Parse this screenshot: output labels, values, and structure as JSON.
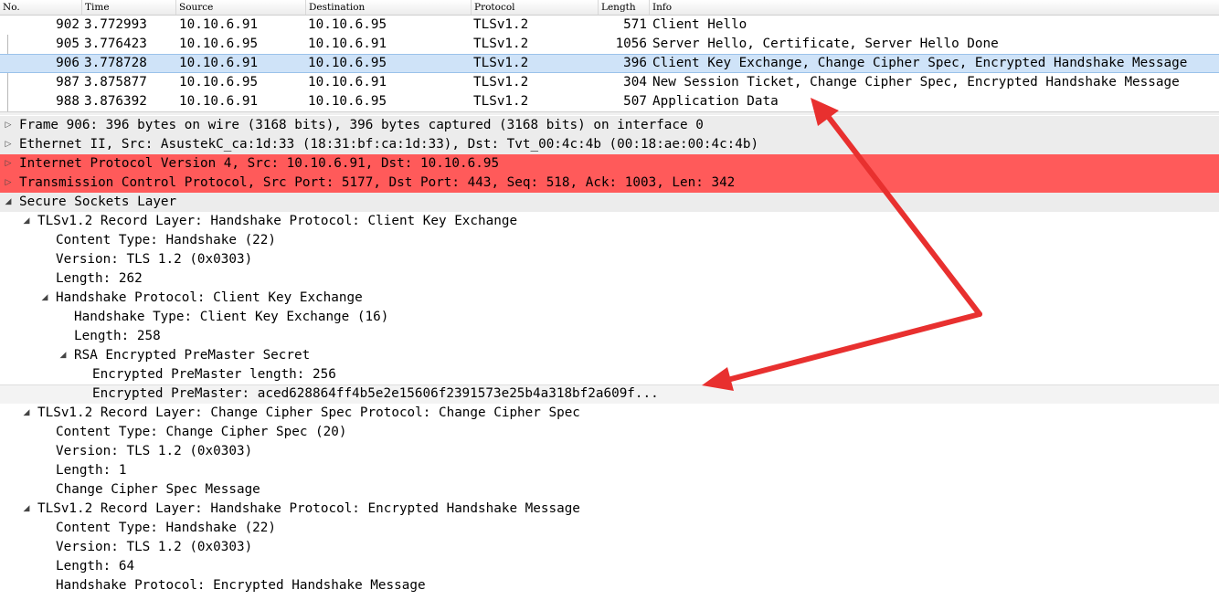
{
  "packet_list": {
    "columns": [
      "No.",
      "Time",
      "Source",
      "Destination",
      "Protocol",
      "Length",
      "Info"
    ],
    "rows": [
      {
        "no": "902",
        "time": "3.772993",
        "source": "10.10.6.91",
        "destination": "10.10.6.95",
        "protocol": "TLSv1.2",
        "length": "571",
        "info": "Client Hello"
      },
      {
        "no": "905",
        "time": "3.776423",
        "source": "10.10.6.95",
        "destination": "10.10.6.91",
        "protocol": "TLSv1.2",
        "length": "1056",
        "info": "Server Hello, Certificate, Server Hello Done"
      },
      {
        "no": "906",
        "time": "3.778728",
        "source": "10.10.6.91",
        "destination": "10.10.6.95",
        "protocol": "TLSv1.2",
        "length": "396",
        "info": "Client Key Exchange, Change Cipher Spec, Encrypted Handshake Message"
      },
      {
        "no": "987",
        "time": "3.875877",
        "source": "10.10.6.95",
        "destination": "10.10.6.91",
        "protocol": "TLSv1.2",
        "length": "304",
        "info": "New Session Ticket, Change Cipher Spec, Encrypted Handshake Message"
      },
      {
        "no": "988",
        "time": "3.876392",
        "source": "10.10.6.91",
        "destination": "10.10.6.95",
        "protocol": "TLSv1.2",
        "length": "507",
        "info": "Application Data"
      }
    ]
  },
  "details": {
    "lines": [
      {
        "text": "Frame 906: 396 bytes on wire (3168 bits), 396 bytes captured (3168 bits) on interface 0"
      },
      {
        "text": "Ethernet II, Src: AsustekC_ca:1d:33 (18:31:bf:ca:1d:33), Dst: Tvt_00:4c:4b (00:18:ae:00:4c:4b)"
      },
      {
        "text": "Internet Protocol Version 4, Src: 10.10.6.91, Dst: 10.10.6.95"
      },
      {
        "text": "Transmission Control Protocol, Src Port: 5177, Dst Port: 443, Seq: 518, Ack: 1003, Len: 342"
      },
      {
        "text": "Secure Sockets Layer"
      },
      {
        "text": "TLSv1.2 Record Layer: Handshake Protocol: Client Key Exchange"
      },
      {
        "text": "Content Type: Handshake (22)"
      },
      {
        "text": "Version: TLS 1.2 (0x0303)"
      },
      {
        "text": "Length: 262"
      },
      {
        "text": "Handshake Protocol: Client Key Exchange"
      },
      {
        "text": "Handshake Type: Client Key Exchange (16)"
      },
      {
        "text": "Length: 258"
      },
      {
        "text": "RSA Encrypted PreMaster Secret"
      },
      {
        "text": "Encrypted PreMaster length: 256"
      },
      {
        "text": "Encrypted PreMaster: aced628864ff4b5e2e15606f2391573e25b4a318bf2a609f..."
      },
      {
        "text": "TLSv1.2 Record Layer: Change Cipher Spec Protocol: Change Cipher Spec"
      },
      {
        "text": "Content Type: Change Cipher Spec (20)"
      },
      {
        "text": "Version: TLS 1.2 (0x0303)"
      },
      {
        "text": "Length: 1"
      },
      {
        "text": "Change Cipher Spec Message"
      },
      {
        "text": "TLSv1.2 Record Layer: Handshake Protocol: Encrypted Handshake Message"
      },
      {
        "text": "Content Type: Handshake (22)"
      },
      {
        "text": "Version: TLS 1.2 (0x0303)"
      },
      {
        "text": "Length: 64"
      },
      {
        "text": "Handshake Protocol: Encrypted Handshake Message"
      }
    ]
  },
  "icons": {
    "collapsed": "expand-triangle-icon",
    "expanded": "collapse-triangle-icon"
  },
  "colors": {
    "selected_row": "#cfe3f8",
    "error_row": "#ff5a5a",
    "header_row": "#ececec",
    "annotation_arrow": "#e8302f"
  }
}
